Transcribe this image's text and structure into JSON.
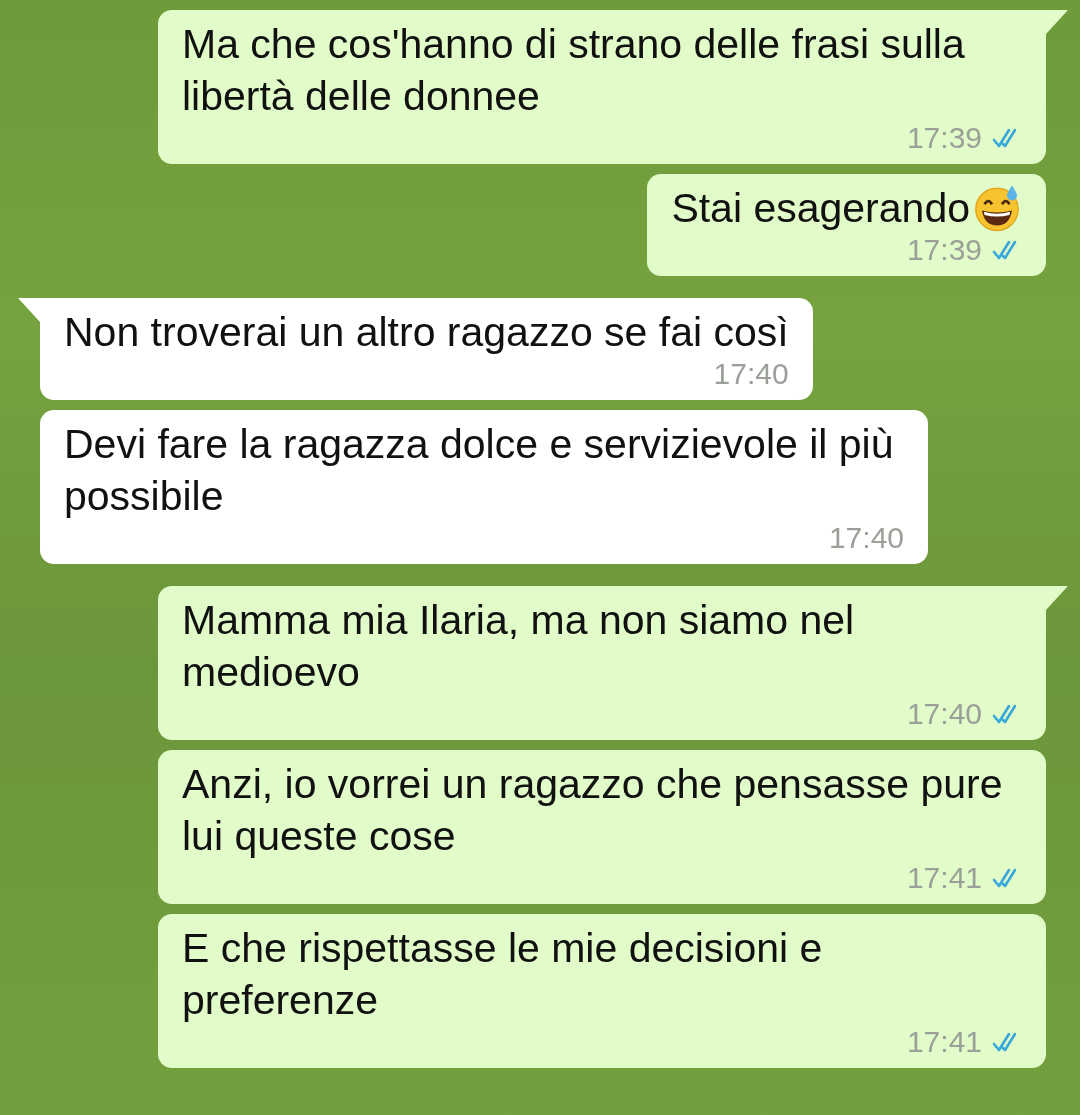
{
  "messages": [
    {
      "kind": "sent",
      "tail": true,
      "text": "Ma che cos'hanno di strano delle frasi sulla libertà delle donnee",
      "emoji": false,
      "time": "17:39",
      "read": true
    },
    {
      "kind": "sent",
      "tail": false,
      "text": "Stai esagerando",
      "emoji": true,
      "time": "17:39",
      "read": true
    },
    {
      "kind": "received",
      "tail": true,
      "text": "Non troverai un altro ragazzo se fai così",
      "emoji": false,
      "time": "17:40",
      "read": false
    },
    {
      "kind": "received",
      "tail": false,
      "text": "Devi fare la ragazza dolce e servizievole il più possibile",
      "emoji": false,
      "time": "17:40",
      "read": false
    },
    {
      "kind": "sent",
      "tail": true,
      "text": "Mamma mia Ilaria, ma non siamo nel medioevo",
      "emoji": false,
      "time": "17:40",
      "read": true
    },
    {
      "kind": "sent",
      "tail": false,
      "text": "Anzi, io vorrei un ragazzo che pensasse pure lui queste cose",
      "emoji": false,
      "time": "17:41",
      "read": true
    },
    {
      "kind": "sent",
      "tail": false,
      "text": "E che rispettasse le mie decisioni e preferenze",
      "emoji": false,
      "time": "17:41",
      "read": true
    }
  ]
}
